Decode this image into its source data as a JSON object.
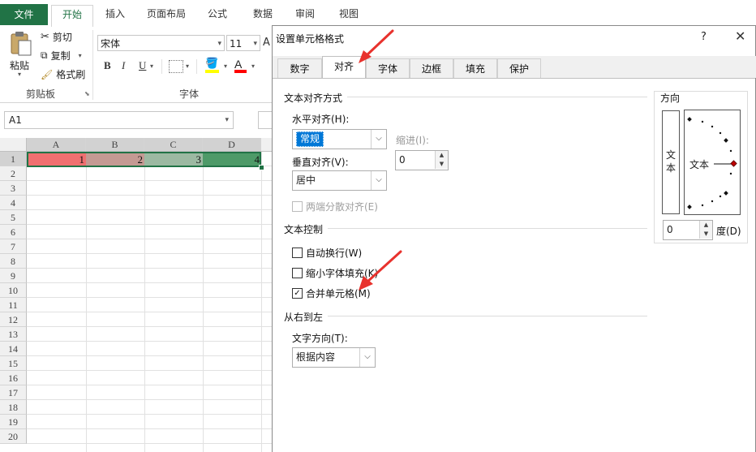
{
  "ribbon": {
    "tabs": [
      "文件",
      "开始",
      "插入",
      "页面布局",
      "公式",
      "数据",
      "审阅",
      "视图"
    ],
    "paste_label": "粘贴",
    "cut_label": "剪切",
    "copy_label": "复制",
    "painter_label": "格式刷",
    "clipboard_group": "剪贴板",
    "font_name": "宋体",
    "font_size": "11",
    "font_group": "字体",
    "bold": "B",
    "italic": "I",
    "underline": "U",
    "font_color_letter": "A",
    "font_color": "#ff0000",
    "fill_color": "#ffff00"
  },
  "namebox": {
    "value": "A1"
  },
  "sheet": {
    "columns": [
      "A",
      "B",
      "C",
      "D"
    ],
    "rows": [
      "1",
      "2",
      "3",
      "4",
      "5",
      "6",
      "7",
      "8",
      "9",
      "10",
      "11",
      "12",
      "13",
      "14",
      "15",
      "16",
      "17",
      "18",
      "19",
      "20"
    ],
    "row1_values": [
      "1",
      "2",
      "3",
      "4"
    ],
    "row1_colors": [
      "#f07070",
      "#c49a93",
      "#9cb9a2",
      "#4e9a68"
    ]
  },
  "dialog": {
    "title": "设置单元格格式",
    "help": "?",
    "close": "✕",
    "tabs": [
      "数字",
      "对齐",
      "字体",
      "边框",
      "填充",
      "保护"
    ],
    "active_tab": "对齐",
    "text_align_section": "文本对齐方式",
    "horizontal_label": "水平对齐(H):",
    "horizontal_value": "常规",
    "indent_label": "缩进(I):",
    "indent_value": "0",
    "vertical_label": "垂直对齐(V):",
    "vertical_value": "居中",
    "justify_distributed": "两端分散对齐(E)",
    "text_control_section": "文本控制",
    "wrap_text": "自动换行(W)",
    "shrink_to_fit": "缩小字体填充(K)",
    "merge_cells": "合并单元格(M)",
    "merge_checked": true,
    "rtl_section": "从右到左",
    "text_direction_label": "文字方向(T):",
    "text_direction_value": "根据内容",
    "orientation_section": "方向",
    "orientation_vertical_text": "文本",
    "orientation_horizontal_text": "文本",
    "degree_value": "0",
    "degree_label": "度(D)"
  }
}
